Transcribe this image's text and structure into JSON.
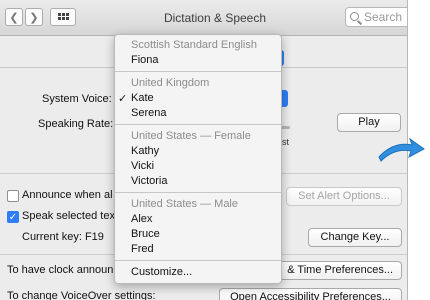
{
  "window": {
    "title": "Dictation & Speech",
    "search_placeholder": "Search"
  },
  "nav": {
    "back_icon": "chevron-left",
    "forward_icon": "chevron-right",
    "grid_icon": "show-all-grid"
  },
  "panel": {
    "system_voice_label": "System Voice:",
    "speaking_rate_label": "Speaking Rate:",
    "play_button": "Play",
    "rate_tick_fast": "st",
    "announce_checkbox_label": "Announce when al",
    "announce_checked": false,
    "set_alert_options_button": "Set Alert Options...",
    "speak_selected_label": "Speak selected tex",
    "speak_selected_checked": true,
    "current_key_label": "Current key: F19",
    "change_key_button": "Change Key...",
    "clock_text": "To have clock announ",
    "clock_button": "& Time Preferences...",
    "voiceover_text": "To change VoiceOver settings:",
    "voiceover_button": "Open Accessibility Preferences..."
  },
  "menu": {
    "groups": [
      {
        "header": "Scottish Standard English",
        "items": [
          {
            "label": "Fiona",
            "checked": false
          }
        ]
      },
      {
        "header": "United Kingdom",
        "items": [
          {
            "label": "Kate",
            "checked": true
          },
          {
            "label": "Serena",
            "checked": false
          }
        ]
      },
      {
        "header": "United States — Female",
        "items": [
          {
            "label": "Kathy",
            "checked": false
          },
          {
            "label": "Vicki",
            "checked": false
          },
          {
            "label": "Victoria",
            "checked": false
          }
        ]
      },
      {
        "header": "United States — Male",
        "items": [
          {
            "label": "Alex",
            "checked": false
          },
          {
            "label": "Bruce",
            "checked": false
          },
          {
            "label": "Fred",
            "checked": false
          }
        ]
      }
    ],
    "customize": "Customize...",
    "checkmark": "✓"
  },
  "colors": {
    "accent": "#2f7ef5",
    "annotation_arrow": "#2f8fe0"
  }
}
